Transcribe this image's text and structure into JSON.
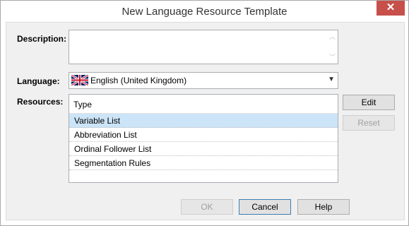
{
  "window": {
    "title": "New Language Resource Template",
    "close_label": "✕"
  },
  "form": {
    "description_label": "Description:",
    "description_value": "",
    "language_label": "Language:",
    "language_value": "English (United Kingdom)",
    "resources_label": "Resources:"
  },
  "resources": {
    "column_header": "Type",
    "items": [
      {
        "label": "Variable List",
        "selected": true
      },
      {
        "label": "Abbreviation List",
        "selected": false
      },
      {
        "label": "Ordinal Follower List",
        "selected": false
      },
      {
        "label": "Segmentation Rules",
        "selected": false
      }
    ]
  },
  "buttons": {
    "edit": "Edit",
    "reset": "Reset",
    "ok": "OK",
    "cancel": "Cancel",
    "help": "Help"
  },
  "colors": {
    "close_button": "#c7504a",
    "selected_row": "#cce4f7",
    "dialog_body": "#f0f0f0"
  },
  "icons": {
    "language_flag": "union-jack-flag-icon",
    "dropdown": "chevron-down-icon",
    "scroll_up": "scroll-up-arrow-icon",
    "scroll_down": "scroll-down-arrow-icon"
  }
}
